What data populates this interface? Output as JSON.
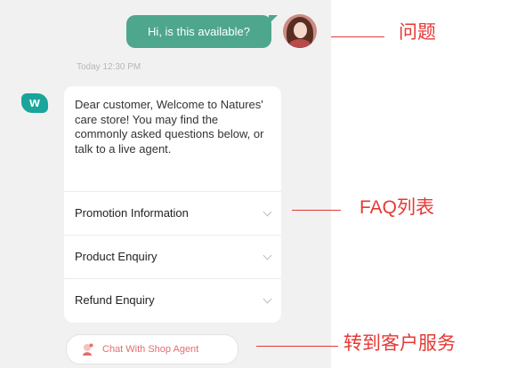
{
  "chat": {
    "user_message": "Hi, is this available?",
    "timestamp": "Today 12:30 PM",
    "bot_logo": "w",
    "greeting": "Dear customer, Welcome to Natures' care store! You may find the commonly asked questions below, or talk to a live agent.",
    "faq": [
      {
        "label": "Promotion Information"
      },
      {
        "label": "Product Enquiry"
      },
      {
        "label": "Refund Enquiry"
      }
    ],
    "agent_button_label": "Chat With Shop Agent"
  },
  "annotations": {
    "question": "问题",
    "faq_list": "FAQ列表",
    "transfer": "转到客户服务"
  },
  "colors": {
    "user_bubble": "#4ea68d",
    "brand_logo": "#1aa59b",
    "agent_accent": "#e56d6d",
    "annotation": "#e53935",
    "panel_bg": "#f1f1f1"
  },
  "icons": [
    "user-avatar",
    "brand-logo",
    "chevron-down-icon",
    "chat-agent-icon"
  ]
}
